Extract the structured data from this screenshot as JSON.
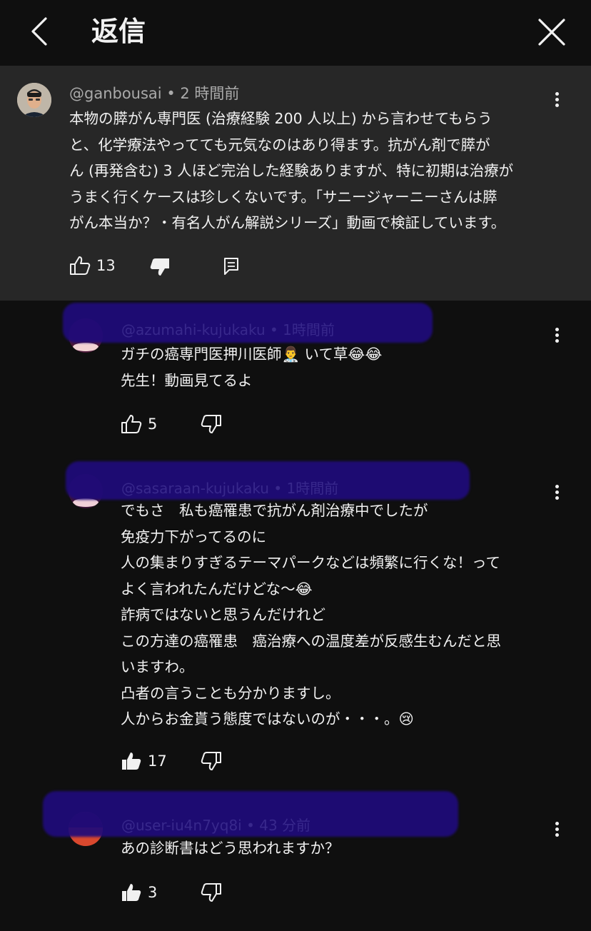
{
  "header": {
    "title": "返信"
  },
  "parent": {
    "author": "@ganbousai",
    "time": "2 時間前",
    "lines": [
      "本物の膵がん専門医 (治療経験 200 人以上) から言わせてもらう",
      "と、化学療法やってても元気なのはあり得ます。抗がん剤で膵が",
      "ん (再発含む) 3 人ほど完治した経験ありますが、特に初期は治療が",
      "うまく行くケースは珍しくないです。「サニージャーニーさんは膵",
      "がん本当か？・有名人がん解説シリーズ」動画で検証しています。"
    ],
    "likes": "13"
  },
  "replies": [
    {
      "author_redacted": "@azumahi-kujukaku",
      "time": "1時間前",
      "lines": [
        "ガチの癌専門医押川医師👨‍⚕️ いて草😂😂",
        "先生！動画見てるよ"
      ],
      "likes": "5"
    },
    {
      "author_redacted": "@sasaraan-kujukaku",
      "time": "1時間前",
      "lines": [
        "でもさ　私も癌罹患で抗がん剤治療中でしたが",
        "免疫力下がってるのに",
        "人の集まりすぎるテーマパークなどは頻繁に行くな！って",
        "よく言われたんだけどな〜😂",
        "詐病ではないと思うんだけれど",
        "この方達の癌罹患　癌治療への温度差が反感生むんだと思",
        "いますわ。",
        "凸者の言うことも分かりますし。",
        "人からお金貰う態度ではないのが・・・。😢"
      ],
      "likes": "17"
    },
    {
      "author_redacted": "@user-iu4n7yq8i",
      "time": "43 分前",
      "lines": [
        "あの診断書はどう思われますか？"
      ],
      "likes": "3"
    }
  ],
  "icons": {
    "back": "chevron-left-icon",
    "close": "close-icon",
    "like": "thumbs-up-icon",
    "dislike": "thumbs-down-icon",
    "reply": "comment-icon",
    "more": "more-vertical-icon"
  },
  "colors": {
    "background": "#0f0f0f",
    "highlight": "#272727",
    "text": "#f1f1f1",
    "meta": "#aaaaaa",
    "redaction": "#1f0b7a"
  }
}
